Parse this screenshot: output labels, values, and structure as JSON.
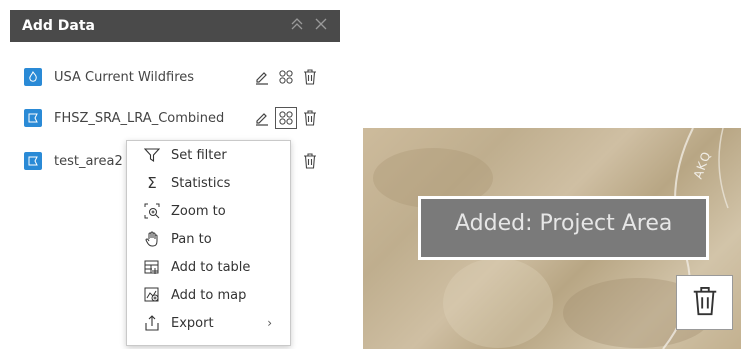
{
  "panel": {
    "title": "Add Data",
    "collapse_icon": "double-chevron-up-icon",
    "close_icon": "close-icon"
  },
  "layers": [
    {
      "name": "USA Current Wildfires",
      "icon": "fire-layer-icon"
    },
    {
      "name": "FHSZ_SRA_LRA_Combined",
      "icon": "polygon-layer-icon"
    },
    {
      "name": "test_area2",
      "icon": "polygon-layer-icon"
    }
  ],
  "menu": {
    "items": [
      {
        "label": "Set filter",
        "icon": "filter-icon"
      },
      {
        "label": "Statistics",
        "icon": "sigma-icon"
      },
      {
        "label": "Zoom to",
        "icon": "zoom-to-icon"
      },
      {
        "label": "Pan to",
        "icon": "hand-icon"
      },
      {
        "label": "Add to table",
        "icon": "add-table-icon"
      },
      {
        "label": "Add to map",
        "icon": "add-map-icon"
      },
      {
        "label": "Export",
        "icon": "export-icon"
      }
    ]
  },
  "map": {
    "label": "Added: Project Area",
    "road_text": "AKQ",
    "delete_icon": "trash-icon"
  },
  "colors": {
    "header_bg": "#4a4a4a",
    "layer_icon": "#2a8ad6",
    "label_bg": "#7a7a7a"
  }
}
